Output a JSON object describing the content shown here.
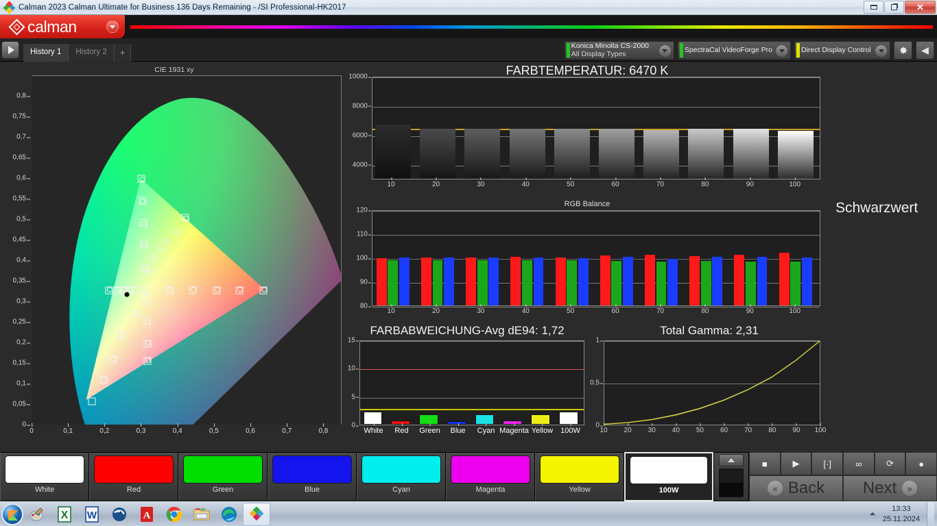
{
  "window": {
    "title": "Calman 2023 Calman Ultimate for Business 136 Days Remaining  - /SI Professional-HK2017",
    "minimize_label": "Minimize",
    "restore_label": "Restore",
    "close_label": "✕"
  },
  "brand": {
    "name": "calman",
    "caret": "chevron-down-icon"
  },
  "toolbar": {
    "play_label": "▶",
    "tabs": [
      {
        "label": "History 1",
        "active": true
      },
      {
        "label": "History 2",
        "active": false
      },
      {
        "label": "+",
        "active": false
      }
    ],
    "devices": [
      {
        "line1": "Konica Minolta CS-2000",
        "line2": "All Display Types",
        "status_color": "#22c722"
      },
      {
        "line1": "SpectraCal VideoForge Pro",
        "line2": "",
        "status_color": "#22c722"
      },
      {
        "line1": "Direct Display Control",
        "line2": "",
        "status_color": "#e3e300"
      }
    ],
    "settings_icon": "gear-icon",
    "collapse_icon": "chevron-left-icon"
  },
  "labels": {
    "black_level": "Schwarzwert"
  },
  "chart_data": [
    {
      "type": "scatter",
      "name": "cie-1931-xy",
      "title": "CIE 1931 xy",
      "xlabel": "x",
      "ylabel": "y",
      "xlim": [
        0,
        0.85
      ],
      "ylim": [
        0,
        0.85
      ],
      "xticks": [
        0,
        0.1,
        0.2,
        0.3,
        0.4,
        0.5,
        0.6,
        0.7,
        0.8
      ],
      "xticklabels": [
        "0",
        "0,1",
        "0,2",
        "0,3",
        "0,4",
        "0,5",
        "0,6",
        "0,7",
        "0,8"
      ],
      "yticks": [
        0,
        0.05,
        0.1,
        0.15,
        0.2,
        0.25,
        0.3,
        0.35,
        0.4,
        0.45,
        0.5,
        0.55,
        0.6,
        0.65,
        0.7,
        0.75,
        0.8
      ],
      "yticklabels": [
        "0",
        "0,05",
        "0,1",
        "0,15",
        "0,2",
        "0,25",
        "0,3",
        "0,35",
        "0,4",
        "0,45",
        "0,5",
        "0,55",
        "0,6",
        "0,65",
        "0,7",
        "0,75",
        "0,8"
      ],
      "grid": false,
      "targets": [
        {
          "x": 0.3,
          "y": 0.6
        },
        {
          "x": 0.304,
          "y": 0.547
        },
        {
          "x": 0.307,
          "y": 0.493
        },
        {
          "x": 0.309,
          "y": 0.44
        },
        {
          "x": 0.311,
          "y": 0.383
        },
        {
          "x": 0.313,
          "y": 0.329
        },
        {
          "x": 0.312,
          "y": 0.304
        },
        {
          "x": 0.285,
          "y": 0.272
        },
        {
          "x": 0.316,
          "y": 0.254
        },
        {
          "x": 0.247,
          "y": 0.22
        },
        {
          "x": 0.317,
          "y": 0.198
        },
        {
          "x": 0.224,
          "y": 0.16
        },
        {
          "x": 0.318,
          "y": 0.157
        },
        {
          "x": 0.197,
          "y": 0.11
        },
        {
          "x": 0.166,
          "y": 0.058
        },
        {
          "x": 0.212,
          "y": 0.329
        },
        {
          "x": 0.236,
          "y": 0.329
        },
        {
          "x": 0.252,
          "y": 0.329
        },
        {
          "x": 0.268,
          "y": 0.329
        },
        {
          "x": 0.286,
          "y": 0.329
        },
        {
          "x": 0.378,
          "y": 0.329
        },
        {
          "x": 0.442,
          "y": 0.329
        },
        {
          "x": 0.508,
          "y": 0.329
        },
        {
          "x": 0.57,
          "y": 0.329
        },
        {
          "x": 0.636,
          "y": 0.329
        },
        {
          "x": 0.421,
          "y": 0.505
        }
      ],
      "measured": [
        {
          "x": 0.302,
          "y": 0.598
        },
        {
          "x": 0.305,
          "y": 0.545
        },
        {
          "x": 0.309,
          "y": 0.49
        },
        {
          "x": 0.311,
          "y": 0.437
        },
        {
          "x": 0.313,
          "y": 0.381
        },
        {
          "x": 0.316,
          "y": 0.322
        },
        {
          "x": 0.314,
          "y": 0.3
        },
        {
          "x": 0.287,
          "y": 0.271
        },
        {
          "x": 0.318,
          "y": 0.252
        },
        {
          "x": 0.249,
          "y": 0.222
        },
        {
          "x": 0.319,
          "y": 0.2
        },
        {
          "x": 0.226,
          "y": 0.162
        },
        {
          "x": 0.32,
          "y": 0.158
        },
        {
          "x": 0.199,
          "y": 0.112
        },
        {
          "x": 0.214,
          "y": 0.33
        },
        {
          "x": 0.238,
          "y": 0.33
        },
        {
          "x": 0.254,
          "y": 0.33
        },
        {
          "x": 0.27,
          "y": 0.33
        },
        {
          "x": 0.38,
          "y": 0.33
        },
        {
          "x": 0.444,
          "y": 0.33
        },
        {
          "x": 0.51,
          "y": 0.33
        },
        {
          "x": 0.572,
          "y": 0.33
        },
        {
          "x": 0.638,
          "y": 0.33
        },
        {
          "x": 0.423,
          "y": 0.503
        },
        {
          "x": 0.35,
          "y": 0.43
        },
        {
          "x": 0.368,
          "y": 0.447
        },
        {
          "x": 0.398,
          "y": 0.47
        },
        {
          "x": 0.335,
          "y": 0.409
        },
        {
          "x": 0.323,
          "y": 0.372
        }
      ],
      "black_point": {
        "x": 0.262,
        "y": 0.318
      }
    },
    {
      "type": "bar",
      "name": "color-temperature",
      "title": "FARBTEMPERATUR: 6470 K",
      "value_text": "6470 K",
      "xlabel": "",
      "ylabel": "K",
      "ylim": [
        3000,
        10000
      ],
      "yticks": [
        4000,
        6000,
        8000,
        10000
      ],
      "yticklabels": [
        "4000",
        "6000",
        "8000",
        "10000"
      ],
      "categories": [
        10,
        20,
        30,
        40,
        50,
        60,
        70,
        80,
        90,
        100
      ],
      "values": [
        6780,
        6510,
        6500,
        6500,
        6500,
        6500,
        6390,
        6500,
        6500,
        6380
      ],
      "reference_line": 6500,
      "reference_color": "#c9a227",
      "bar_grays": [
        "#2b2b2b",
        "#4a4a4a",
        "#5e5e5e",
        "#757575",
        "#8b8b8b",
        "#a0a0a0",
        "#b5b5b5",
        "#cacaca",
        "#e2e2e2",
        "#ffffff"
      ]
    },
    {
      "type": "bar",
      "name": "rgb-balance",
      "title": "RGB Balance",
      "xlabel": "",
      "ylabel": "%",
      "ylim": [
        80,
        120
      ],
      "yticks": [
        80,
        90,
        100,
        110,
        120
      ],
      "yticklabels": [
        "80",
        "90",
        "100",
        "110",
        "120"
      ],
      "categories": [
        10,
        20,
        30,
        40,
        50,
        60,
        70,
        80,
        90,
        100
      ],
      "series": [
        {
          "name": "Red",
          "color": "#ff1a1a",
          "values": [
            100.4,
            100.6,
            100.5,
            100.8,
            100.7,
            101.3,
            101.6,
            101.2,
            101.6,
            102.5
          ]
        },
        {
          "name": "Green",
          "color": "#1aa81a",
          "values": [
            99.4,
            99.4,
            99.3,
            99.3,
            99.3,
            99.2,
            98.9,
            99.1,
            99.0,
            98.8
          ]
        },
        {
          "name": "Blue",
          "color": "#1a3cff",
          "values": [
            100.5,
            100.5,
            100.5,
            100.5,
            100.4,
            100.8,
            100.1,
            100.8,
            100.8,
            100.7
          ]
        }
      ]
    },
    {
      "type": "bar",
      "name": "color-deviation-de94",
      "title": "FARBABWEICHUNG-Avg dE94: 1,72",
      "value_text": "1,72",
      "xlabel": "",
      "ylabel": "dE94",
      "ylim": [
        0,
        15
      ],
      "yticks": [
        0,
        5,
        10,
        15
      ],
      "yticklabels": [
        "0",
        "5",
        "10",
        "15"
      ],
      "categories": [
        "White",
        "Red",
        "Green",
        "Blue",
        "Cyan",
        "Magenta",
        "Yellow",
        "100W"
      ],
      "values": [
        2.6,
        1.0,
        2.0,
        0.8,
        2.0,
        1.0,
        2.1,
        2.6
      ],
      "bar_colors": [
        "#ffffff",
        "#ee1111",
        "#16dd16",
        "#1133ee",
        "#19e2e2",
        "#ee22ee",
        "#eded16",
        "#ffffff"
      ],
      "warn_line": 10,
      "warn_color": "#d9534f",
      "ok_line": 3,
      "ok_color": "#c9c700"
    },
    {
      "type": "line",
      "name": "total-gamma",
      "title": "Total Gamma: 2,31",
      "value_text": "2,31",
      "xlabel": "",
      "ylabel": "",
      "xlim": [
        10,
        100
      ],
      "ylim": [
        0,
        1
      ],
      "xticks": [
        10,
        20,
        30,
        40,
        50,
        60,
        70,
        80,
        90,
        100
      ],
      "xticklabels": [
        "10",
        "20",
        "30",
        "40",
        "50",
        "60",
        "70",
        "80",
        "90",
        "100"
      ],
      "yticks": [
        0,
        0.5,
        1
      ],
      "yticklabels": [
        "0",
        "0,5",
        "1"
      ],
      "gamma": 2.31,
      "series": [
        {
          "name": "Target",
          "color": "#c9c9c9",
          "x": [
            10,
            20,
            30,
            40,
            50,
            60,
            70,
            80,
            90,
            100
          ],
          "y": [
            0.006,
            0.026,
            0.063,
            0.119,
            0.196,
            0.296,
            0.42,
            0.57,
            0.77,
            1.0
          ]
        },
        {
          "name": "Measured",
          "color": "#d8d820",
          "x": [
            10,
            20,
            30,
            40,
            50,
            60,
            70,
            80,
            90,
            100
          ],
          "y": [
            0.005,
            0.024,
            0.06,
            0.115,
            0.192,
            0.292,
            0.417,
            0.568,
            0.768,
            1.0
          ]
        }
      ]
    }
  ],
  "swatches": [
    {
      "label": "White",
      "color": "#ffffff",
      "current": false
    },
    {
      "label": "Red",
      "color": "#fe0000",
      "current": false
    },
    {
      "label": "Green",
      "color": "#00dd00",
      "current": false
    },
    {
      "label": "Blue",
      "color": "#1414ef",
      "current": false
    },
    {
      "label": "Cyan",
      "color": "#00eeee",
      "current": false
    },
    {
      "label": "Magenta",
      "color": "#ee00ee",
      "current": false
    },
    {
      "label": "Yellow",
      "color": "#f5f500",
      "current": false
    },
    {
      "label": "100W",
      "color": "#ffffff",
      "current": true
    }
  ],
  "transport": {
    "monitor_icon": "monitor-preview",
    "buttons": [
      {
        "icon": "stop-icon",
        "glyph": "■"
      },
      {
        "icon": "play-icon",
        "glyph": "▶"
      },
      {
        "icon": "bracket-icon",
        "glyph": "[·]"
      },
      {
        "icon": "loop-icon",
        "glyph": "∞"
      },
      {
        "icon": "refresh-icon",
        "glyph": "⟳"
      },
      {
        "icon": "circle-icon",
        "glyph": "●"
      }
    ],
    "back_label": "Back",
    "next_label": "Next",
    "back_chevron": "«",
    "next_chevron": "»"
  },
  "taskbar": {
    "start_label": "Start",
    "apps": [
      {
        "name": "paint-icon",
        "glyph": "🎨"
      },
      {
        "name": "excel-icon",
        "glyph": "X"
      },
      {
        "name": "word-icon",
        "glyph": "W"
      },
      {
        "name": "thunderbird-icon",
        "glyph": "T"
      },
      {
        "name": "acrobat-icon",
        "glyph": "A"
      },
      {
        "name": "chrome-icon",
        "glyph": "C"
      },
      {
        "name": "explorer-icon",
        "glyph": "E"
      },
      {
        "name": "edge-icon",
        "glyph": "e"
      },
      {
        "name": "calman-icon",
        "glyph": "◆"
      }
    ],
    "tray_icon": "show-hidden-icons",
    "time": "13:33",
    "date": "25.11.2024"
  }
}
